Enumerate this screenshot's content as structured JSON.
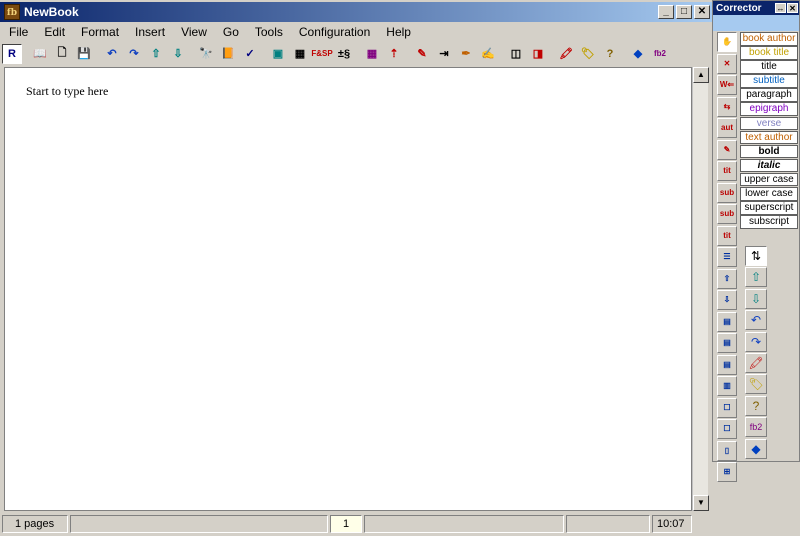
{
  "window": {
    "title": "NewBook",
    "app_icon_text": "fb"
  },
  "window_buttons": {
    "minimize": "_",
    "maximize": "□",
    "close": "✕"
  },
  "menu": [
    "File",
    "Edit",
    "Format",
    "Insert",
    "View",
    "Go",
    "Tools",
    "Configuration",
    "Help"
  ],
  "toolbar": [
    {
      "name": "reader-icon",
      "glyph": "R",
      "color": "#000080"
    },
    {
      "sep": true
    },
    {
      "name": "open-book-icon",
      "glyph": "📖",
      "color": "#8b5a00"
    },
    {
      "name": "new-document-icon",
      "glyph": "🗋",
      "color": "#000"
    },
    {
      "name": "save-icon",
      "glyph": "💾",
      "color": "#000080"
    },
    {
      "sep": true
    },
    {
      "name": "undo-icon",
      "glyph": "↶",
      "color": "#1040c0"
    },
    {
      "name": "redo-icon",
      "glyph": "↷",
      "color": "#1040c0"
    },
    {
      "name": "arrow-up-icon",
      "glyph": "⇧",
      "color": "#008080"
    },
    {
      "name": "arrow-down-icon",
      "glyph": "⇩",
      "color": "#008080"
    },
    {
      "sep": true
    },
    {
      "name": "find-icon",
      "glyph": "🔭",
      "color": "#000"
    },
    {
      "name": "book-icon",
      "glyph": "📙",
      "color": "#8b5a00"
    },
    {
      "name": "spellcheck-icon",
      "glyph": "✓",
      "color": "#000080"
    },
    {
      "sep": true
    },
    {
      "name": "image-icon",
      "glyph": "▣",
      "color": "#008080"
    },
    {
      "name": "table-icon",
      "glyph": "▦",
      "color": "#000"
    },
    {
      "name": "find-replace-icon",
      "glyph": "F&SP",
      "color": "#c00000"
    },
    {
      "name": "special-chars-icon",
      "glyph": "±§",
      "color": "#000"
    },
    {
      "sep": true
    },
    {
      "name": "grid-icon",
      "glyph": "▦",
      "color": "#800080"
    },
    {
      "name": "merge-icon",
      "glyph": "⇡",
      "color": "#c00000"
    },
    {
      "sep": true
    },
    {
      "name": "edit-icon",
      "glyph": "✎",
      "color": "#c00000"
    },
    {
      "name": "insert-icon",
      "glyph": "⇥",
      "color": "#000"
    },
    {
      "name": "pen-icon",
      "glyph": "✒",
      "color": "#c06000"
    },
    {
      "name": "html-icon",
      "glyph": "✍",
      "color": "#806000"
    },
    {
      "sep": true
    },
    {
      "name": "split-icon",
      "glyph": "◫",
      "color": "#000"
    },
    {
      "name": "view-icon",
      "glyph": "◨",
      "color": "#c00000"
    },
    {
      "sep": true
    },
    {
      "name": "marker-icon",
      "glyph": "🖍",
      "color": "#c00000"
    },
    {
      "name": "eraser-icon",
      "glyph": "🏷",
      "color": "#c0a000"
    },
    {
      "name": "help-icon",
      "glyph": "?",
      "color": "#806000"
    },
    {
      "sep": true
    },
    {
      "name": "validate-icon",
      "glyph": "◆",
      "color": "#0040c0"
    },
    {
      "name": "fb2-icon",
      "glyph": "fb2",
      "color": "#800080"
    }
  ],
  "editor": {
    "text": "Start to type here"
  },
  "status": {
    "pages": "1 pages",
    "page_number": "1",
    "time": "10:07"
  },
  "corrector": {
    "title": "Corrector",
    "pin": "↔",
    "close": "✕",
    "style_buttons": [
      {
        "label": "book author",
        "color": "#c06000"
      },
      {
        "label": "book title",
        "color": "#c0a000"
      },
      {
        "label": "title",
        "color": "#000"
      },
      {
        "label": "subtitle",
        "color": "#0060c0"
      },
      {
        "label": "paragraph",
        "color": "#000"
      },
      {
        "label": "epigraph",
        "color": "#8000c0"
      },
      {
        "label": "verse",
        "color": "#8080c0"
      },
      {
        "label": "text author",
        "color": "#c06000"
      },
      {
        "label": "bold",
        "color": "#000"
      },
      {
        "label": "italic",
        "color": "#000"
      },
      {
        "label": "upper case",
        "color": "#000"
      },
      {
        "label": "lower case",
        "color": "#000"
      },
      {
        "label": "superscript",
        "color": "#000"
      },
      {
        "label": "subscript",
        "color": "#000"
      }
    ],
    "left_tools": [
      {
        "name": "hand-icon",
        "glyph": "✋"
      },
      {
        "name": "delete-icon",
        "glyph": "✕"
      },
      {
        "name": "word-icon",
        "glyph": "W⇐"
      },
      {
        "name": "reflow-icon",
        "glyph": "⇆"
      },
      {
        "name": "auto-text-icon",
        "glyph": "aut"
      },
      {
        "name": "marker-tool-icon",
        "glyph": "✎"
      },
      {
        "name": "tit-icon",
        "glyph": "tit"
      },
      {
        "name": "sub-icon",
        "glyph": "sub"
      },
      {
        "name": "sub-tit-icon",
        "glyph": "sub"
      },
      {
        "name": "tit-sub-icon",
        "glyph": "tit"
      },
      {
        "name": "list-icon",
        "glyph": "☰"
      },
      {
        "name": "move-up-icon",
        "glyph": "⇧"
      },
      {
        "name": "move-down-icon",
        "glyph": "⇩"
      },
      {
        "name": "section-icon",
        "glyph": "▤"
      },
      {
        "name": "section2-icon",
        "glyph": "▤"
      },
      {
        "name": "section3-icon",
        "glyph": "▤"
      },
      {
        "name": "section4-icon",
        "glyph": "▥"
      },
      {
        "name": "frame-icon",
        "glyph": "☐"
      },
      {
        "name": "frame2-icon",
        "glyph": "☐"
      },
      {
        "name": "page-icon",
        "glyph": "▯"
      },
      {
        "name": "expand-icon",
        "glyph": "⊞"
      }
    ],
    "right_tools": [
      {
        "name": "sort-icon",
        "glyph": "⇅",
        "color": "#000"
      },
      {
        "name": "up-icon",
        "glyph": "⇧",
        "color": "#008080"
      },
      {
        "name": "down-icon",
        "glyph": "⇩",
        "color": "#008080"
      },
      {
        "name": "undo-tool-icon",
        "glyph": "↶",
        "color": "#1040c0"
      },
      {
        "name": "redo-tool-icon",
        "glyph": "↷",
        "color": "#1040c0"
      },
      {
        "name": "marker2-icon",
        "glyph": "🖍",
        "color": "#c00000"
      },
      {
        "name": "eraser2-icon",
        "glyph": "🏷",
        "color": "#c0a000"
      },
      {
        "name": "help2-icon",
        "glyph": "?",
        "color": "#806000"
      },
      {
        "name": "fb2-tool-icon",
        "glyph": "fb2",
        "color": "#800080"
      },
      {
        "name": "validate2-icon",
        "glyph": "◆",
        "color": "#0040c0"
      }
    ]
  }
}
